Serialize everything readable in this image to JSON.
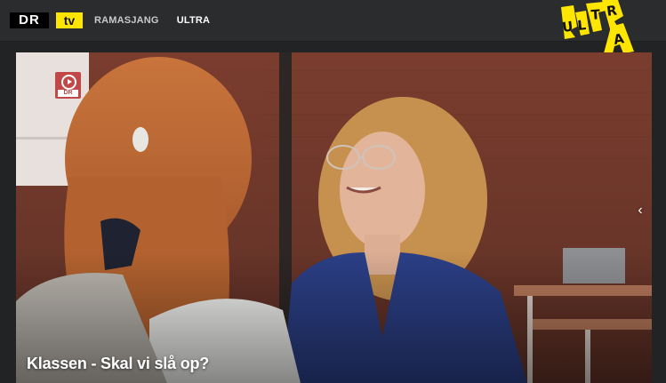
{
  "header": {
    "logo_dr": "DR",
    "logo_tv": "tv",
    "nav": [
      {
        "label": "RAMASJANG",
        "active": false
      },
      {
        "label": "ULTRA",
        "active": true
      }
    ],
    "brand_logo_text": "ULTRA",
    "brand_color": "#ffe600"
  },
  "hero": {
    "title": "Klassen - Skal vi slå op?",
    "channel_badge": "DR",
    "next_icon": "chevron-left-icon"
  },
  "colors": {
    "topbar": "#2b2c2e",
    "background": "#222325",
    "accent_yellow": "#ffe600",
    "badge_red": "#c24848"
  }
}
